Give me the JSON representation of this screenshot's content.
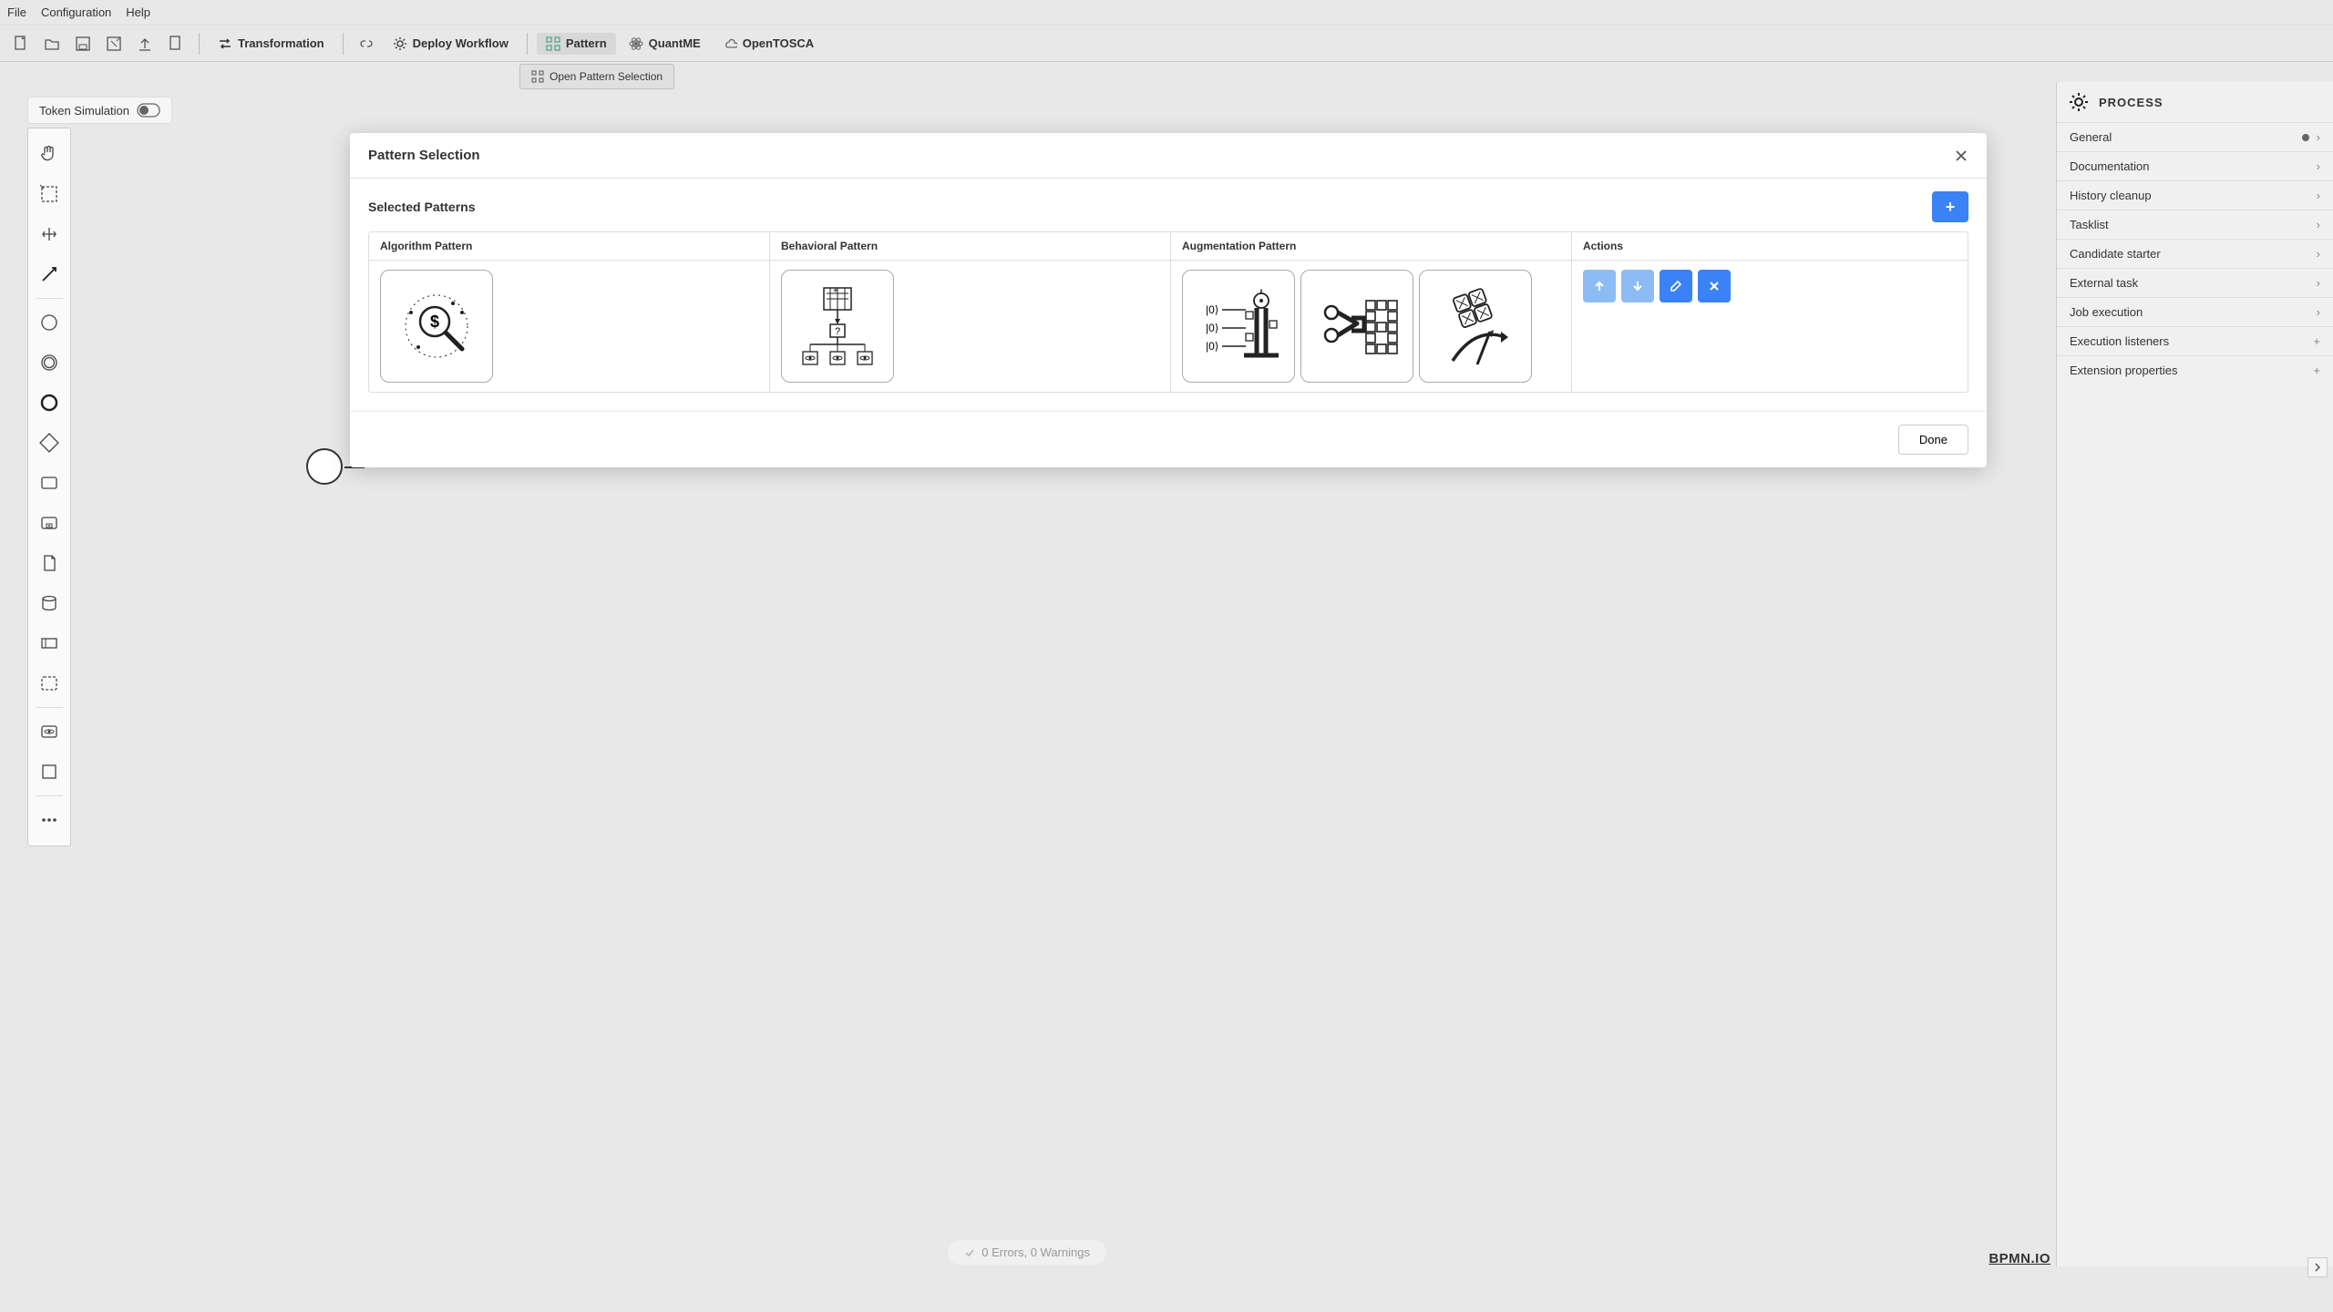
{
  "menubar": {
    "file": "File",
    "configuration": "Configuration",
    "help": "Help"
  },
  "toolbar": {
    "transformation": "Transformation",
    "deploy": "Deploy Workflow",
    "pattern": "Pattern",
    "quantme": "QuantME",
    "opentosca": "OpenTOSCA",
    "open_pattern_selection": "Open Pattern Selection"
  },
  "token_simulation": "Token Simulation",
  "modal": {
    "title": "Pattern Selection",
    "selected_patterns": "Selected Patterns",
    "col_algo": "Algorithm Pattern",
    "col_beh": "Behavioral Pattern",
    "col_aug": "Augmentation Pattern",
    "col_actions": "Actions",
    "add_label": "+",
    "done": "Done"
  },
  "props": {
    "header": "PROCESS",
    "general": "General",
    "documentation": "Documentation",
    "history_cleanup": "History cleanup",
    "tasklist": "Tasklist",
    "candidate_starter": "Candidate starter",
    "external_task": "External task",
    "job_execution": "Job execution",
    "execution_listeners": "Execution listeners",
    "extension_properties": "Extension properties"
  },
  "footer": {
    "errors": "0 Errors, 0 Warnings",
    "brand": "BPMN.IO"
  }
}
